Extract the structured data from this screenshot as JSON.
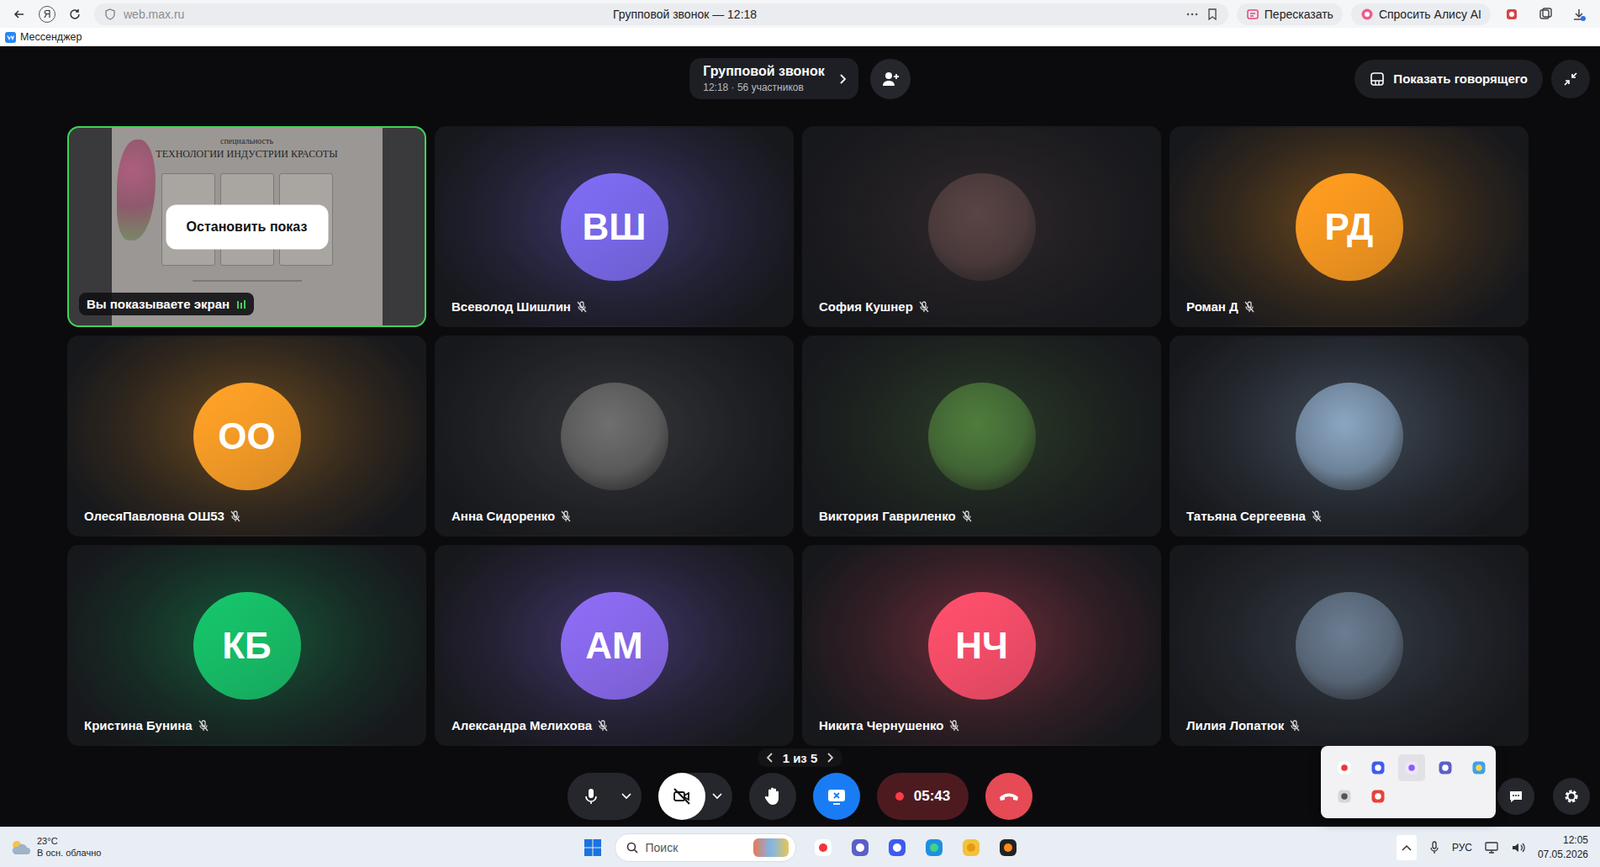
{
  "browser": {
    "logo": "Я",
    "url": "web.max.ru",
    "title": "Групповой звонок — 12:18",
    "actions": [
      {
        "label": "Пересказать",
        "kind": "retell"
      },
      {
        "label": "Спросить Алису AI",
        "kind": "alice"
      }
    ],
    "bookmark": {
      "label": "Мессенджер"
    }
  },
  "call": {
    "title": "Групповой звонок",
    "subtitle": "12:18 · 56 участников",
    "speakerButton": "Показать говорящего"
  },
  "tiles": [
    {
      "kind": "screenshare",
      "label": "Вы показываете экран",
      "button": "Остановить показ",
      "speaking": true,
      "slide": {
        "caption": "специальность",
        "heading": "ТЕХНОЛОГИИ ИНДУСТРИИ КРАСОТЫ"
      }
    },
    {
      "kind": "initials",
      "name": "Всеволод Шишлин",
      "initials": "ВШ",
      "color": "#7d6cf2",
      "muted": true
    },
    {
      "kind": "photo",
      "name": "София Кушнер",
      "color": "#5a4444",
      "muted": true
    },
    {
      "kind": "initials",
      "name": "Роман Д",
      "initials": "РД",
      "color": "#ff9c1f",
      "muted": true
    },
    {
      "kind": "initials",
      "name": "ОлесяПавловна ОШ53",
      "initials": "ОО",
      "color": "#ffa126",
      "muted": true
    },
    {
      "kind": "photo",
      "name": "Анна Сидоренко",
      "color": "#6f6f6f",
      "muted": true
    },
    {
      "kind": "photo",
      "name": "Виктория Гавриленко",
      "color": "#4f7d3c",
      "muted": true
    },
    {
      "kind": "photo",
      "name": "Татьяна Сергеевна",
      "color": "#8aa6c2",
      "muted": true
    },
    {
      "kind": "initials",
      "name": "Кристина Бунина",
      "initials": "КБ",
      "color": "#16c46a",
      "muted": true
    },
    {
      "kind": "initials",
      "name": "Александра Мелихова",
      "initials": "АМ",
      "color": "#8d6cf4",
      "muted": true
    },
    {
      "kind": "initials",
      "name": "Никита Чернушенко",
      "initials": "НЧ",
      "color": "#ff4f6c",
      "muted": true
    },
    {
      "kind": "photo",
      "name": "Лилия Лопатюк",
      "color": "#6b7d92",
      "muted": true
    }
  ],
  "pagination": {
    "label": "1 из 5"
  },
  "controls": {
    "micOn": true,
    "cameraOn": false,
    "sharing": true,
    "recording": true,
    "timer": "05:43"
  },
  "tray": [
    {
      "kind": "yandex",
      "selected": false
    },
    {
      "kind": "camera",
      "selected": false
    },
    {
      "kind": "pen",
      "selected": true
    },
    {
      "kind": "teams",
      "selected": false
    },
    {
      "kind": "app",
      "selected": false
    },
    {
      "kind": "usb",
      "selected": false
    },
    {
      "kind": "office",
      "selected": false
    }
  ],
  "taskbar": {
    "weather": {
      "temp": "23°C",
      "text": "В осн. облачно"
    },
    "search": {
      "placeholder": "Поиск"
    },
    "apps": [
      {
        "kind": "yandex"
      },
      {
        "kind": "teams"
      },
      {
        "kind": "camera"
      },
      {
        "kind": "edge"
      },
      {
        "kind": "files"
      },
      {
        "kind": "player"
      }
    ],
    "language": "РУС",
    "time": "12:05",
    "date": "07.05.2026"
  }
}
